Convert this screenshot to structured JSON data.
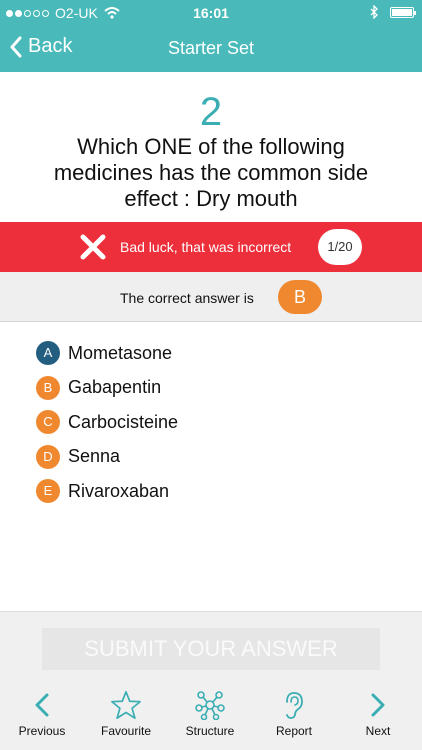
{
  "status": {
    "carrier": "O2-UK",
    "time": "16:01"
  },
  "nav": {
    "back_label": "Back",
    "title": "Starter Set"
  },
  "question": {
    "number": "2",
    "text": "Which ONE of the following medicines has the common side effect : Dry mouth"
  },
  "result": {
    "message": "Bad luck, that was incorrect",
    "progress": "1/20"
  },
  "correct": {
    "label": "The correct answer is",
    "answer": "B"
  },
  "options": [
    {
      "letter": "A",
      "text": "Mometasone"
    },
    {
      "letter": "B",
      "text": "Gabapentin"
    },
    {
      "letter": "C",
      "text": "Carbocisteine"
    },
    {
      "letter": "D",
      "text": "Senna"
    },
    {
      "letter": "E",
      "text": "Rivaroxaban"
    }
  ],
  "submit_label": "SUBMIT YOUR ANSWER",
  "tabs": [
    {
      "label": "Previous",
      "icon": "chevron-left-icon"
    },
    {
      "label": "Favourite",
      "icon": "star-icon"
    },
    {
      "label": "Structure",
      "icon": "structure-icon"
    },
    {
      "label": "Report",
      "icon": "ear-icon"
    },
    {
      "label": "Next",
      "icon": "chevron-right-icon"
    }
  ],
  "colors": {
    "accent": "#4ab9b9",
    "error": "#ec2f3b",
    "option": "#f0882f",
    "selected": "#235d80"
  }
}
